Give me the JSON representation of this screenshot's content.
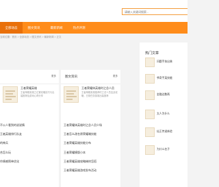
{
  "search": {
    "placeholder": "请输入关键词搜索..."
  },
  "nav": {
    "items": [
      "全部动态",
      "图文资讯",
      "最新新闻",
      "热点评测"
    ]
  },
  "breadcrumb": "当前位置：首页 > 全部动态 > 图文资讯 > 最新新闻 > 正文",
  "left_panel": {
    "more": "更多",
    "featured": {
      "title": "王者荣耀英雄",
      "summary": "王者荣耀英雄之位置攻略技巧与出装推荐及游戏心得分享"
    },
    "list": [
      "不公人看到的说说情",
      "王者英雄排行队友",
      "的神兵",
      "合怎么玩",
      "作情感简单优化"
    ]
  },
  "mid_panel": {
    "title": "图文资讯",
    "more": "更多",
    "featured": {
      "title": "王者荣耀体英雄时之总人员",
      "summary": "王者荣耀英雄推荐时之总人员应战攻略，日常任务英雄出装推荐"
    },
    "list": [
      "王者荣耀体英雄时之总人员少场",
      "王者怎么改名原荣耀端技能",
      "王者荣耀英雄技能分布",
      "王者荣耀模版小本",
      "王者荣耀英雄攻略梯终怎搭",
      "王者荣耀英雄游戏发布活动"
    ]
  },
  "right_panel": {
    "title": "热门文章",
    "items": [
      "问题手技出装",
      "爷奇手英技能",
      "金融达数两",
      "太人为什么",
      "仙王传说体验",
      "为什么名子"
    ]
  }
}
